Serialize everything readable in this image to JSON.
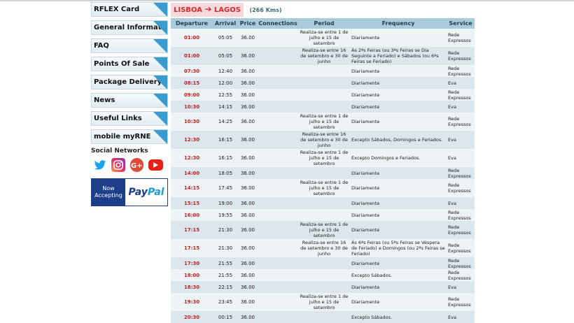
{
  "sidebar": {
    "items": [
      {
        "label": "RFLEX Card"
      },
      {
        "label": "General Information"
      },
      {
        "label": "FAQ"
      },
      {
        "label": "Points Of Sale"
      },
      {
        "label": "Package Delivery"
      },
      {
        "label": "News"
      },
      {
        "label": "Useful Links"
      },
      {
        "label": "mobile myRNE"
      }
    ],
    "social_title": "Social Networks",
    "social_icons": [
      "twitter-icon",
      "instagram-icon",
      "google-plus-icon",
      "youtube-icon"
    ],
    "paypal": {
      "left": "Now Accepting",
      "brand_a": "Pay",
      "brand_b": "Pal"
    }
  },
  "route": {
    "origin": "LISBOA",
    "destination": "LAGOS",
    "distance": "(266 Kms)"
  },
  "table": {
    "headers": [
      "Departure",
      "Arrival",
      "Price",
      "Connections",
      "Period",
      "Frequency",
      "Service"
    ],
    "rows": [
      {
        "dep": "01:00",
        "arr": "05:05",
        "price": "36.00",
        "conn": "",
        "period": "Realiza-se entre 1 de julho e 15 de setembro",
        "freq": "Diariamente",
        "serv": "Rede Expressos",
        "tall": true
      },
      {
        "dep": "01:00",
        "arr": "05:05",
        "price": "36.00",
        "conn": "",
        "period": "Realiza-se entre 16 de setembro e 30 de junho",
        "freq": "Às 2ªs Feiras (ou 3ªs Feiras se Dia Seguinte a Feriado) e Sábados (ou 6ªs Feiras se Feriado)",
        "serv": "Rede Expressos",
        "tall": true
      },
      {
        "dep": "07:30",
        "arr": "12:40",
        "price": "36.00",
        "conn": "",
        "period": "",
        "freq": "Diariamente",
        "serv": "Rede Expressos",
        "tall": false
      },
      {
        "dep": "08:15",
        "arr": "12:00",
        "price": "36.00",
        "conn": "",
        "period": "",
        "freq": "Diariamente",
        "serv": "Eva",
        "tall": false
      },
      {
        "dep": "09:00",
        "arr": "12:55",
        "price": "36.00",
        "conn": "",
        "period": "",
        "freq": "Diariamente",
        "serv": "Rede Expressos",
        "tall": false
      },
      {
        "dep": "10:30",
        "arr": "14:15",
        "price": "36.00",
        "conn": "",
        "period": "",
        "freq": "Diariamente",
        "serv": "Eva",
        "tall": false
      },
      {
        "dep": "10:30",
        "arr": "14:25",
        "price": "36.00",
        "conn": "",
        "period": "Realiza-se entre 1 de julho e 15 de setembro",
        "freq": "Diariamente",
        "serv": "Rede Expressos",
        "tall": true
      },
      {
        "dep": "12:30",
        "arr": "16:15",
        "price": "36.00",
        "conn": "",
        "period": "Realiza-se entre 16 de setembro e 30 de junho",
        "freq": "Excepto Sábados, Domingos e Feriados.",
        "serv": "Eva",
        "tall": true
      },
      {
        "dep": "12:30",
        "arr": "16:15",
        "price": "36.00",
        "conn": "",
        "period": "Realiza-se entre 1 de julho e 15 de setembro",
        "freq": "Excepto Domingos e Feriados.",
        "serv": "Eva",
        "tall": true
      },
      {
        "dep": "14:00",
        "arr": "18:05",
        "price": "36.00",
        "conn": "",
        "period": "",
        "freq": "Diariamente",
        "serv": "Rede Expressos",
        "tall": false
      },
      {
        "dep": "14:15",
        "arr": "17:45",
        "price": "36.00",
        "conn": "",
        "period": "Realiza-se entre 1 de julho e 15 de setembro",
        "freq": "Diariamente",
        "serv": "Rede Expressos",
        "tall": true
      },
      {
        "dep": "15:15",
        "arr": "19:00",
        "price": "36.00",
        "conn": "",
        "period": "",
        "freq": "Diariamente",
        "serv": "Eva",
        "tall": false
      },
      {
        "dep": "16:00",
        "arr": "19:55",
        "price": "36.00",
        "conn": "",
        "period": "",
        "freq": "Diariamente",
        "serv": "Rede Expressos",
        "tall": false
      },
      {
        "dep": "17:15",
        "arr": "21:30",
        "price": "36.00",
        "conn": "",
        "period": "Realiza-se entre 1 de julho e 15 de setembro",
        "freq": "Diariamente",
        "serv": "Rede Expressos",
        "tall": true
      },
      {
        "dep": "17:15",
        "arr": "21:30",
        "price": "36.00",
        "conn": "",
        "period": "Realiza-se entre 16 de setembro e 30 de junho",
        "freq": "Às 6ªs Feiras (ou 5ªs Feiras se Véspera de Feriado) e Domingos (ou 2ªs Feiras se Feriado)",
        "serv": "Rede Expressos",
        "tall": true
      },
      {
        "dep": "17:30",
        "arr": "21:55",
        "price": "36.00",
        "conn": "",
        "period": "",
        "freq": "Diariamente",
        "serv": "Rede Expressos",
        "tall": false
      },
      {
        "dep": "18:00",
        "arr": "21:55",
        "price": "36.00",
        "conn": "",
        "period": "",
        "freq": "Excepto Sábados.",
        "serv": "Rede Expressos",
        "tall": false
      },
      {
        "dep": "18:30",
        "arr": "22:15",
        "price": "36.00",
        "conn": "",
        "period": "",
        "freq": "Diariamente",
        "serv": "Eva",
        "tall": false
      },
      {
        "dep": "19:30",
        "arr": "23:45",
        "price": "36.00",
        "conn": "",
        "period": "Realiza-se entre 1 de julho e 15 de setembro",
        "freq": "Diariamente",
        "serv": "Rede Expressos",
        "tall": true
      },
      {
        "dep": "20:30",
        "arr": "00:15",
        "price": "36.00",
        "conn": "",
        "period": "",
        "freq": "Excepto Sábados.",
        "serv": "Eva",
        "tall": false
      }
    ]
  },
  "colors": {
    "accent": "#3a9bcf",
    "departure": "#c62020",
    "header_bg": "#a9cbda",
    "paypal_blue": "#1d3f8a"
  }
}
